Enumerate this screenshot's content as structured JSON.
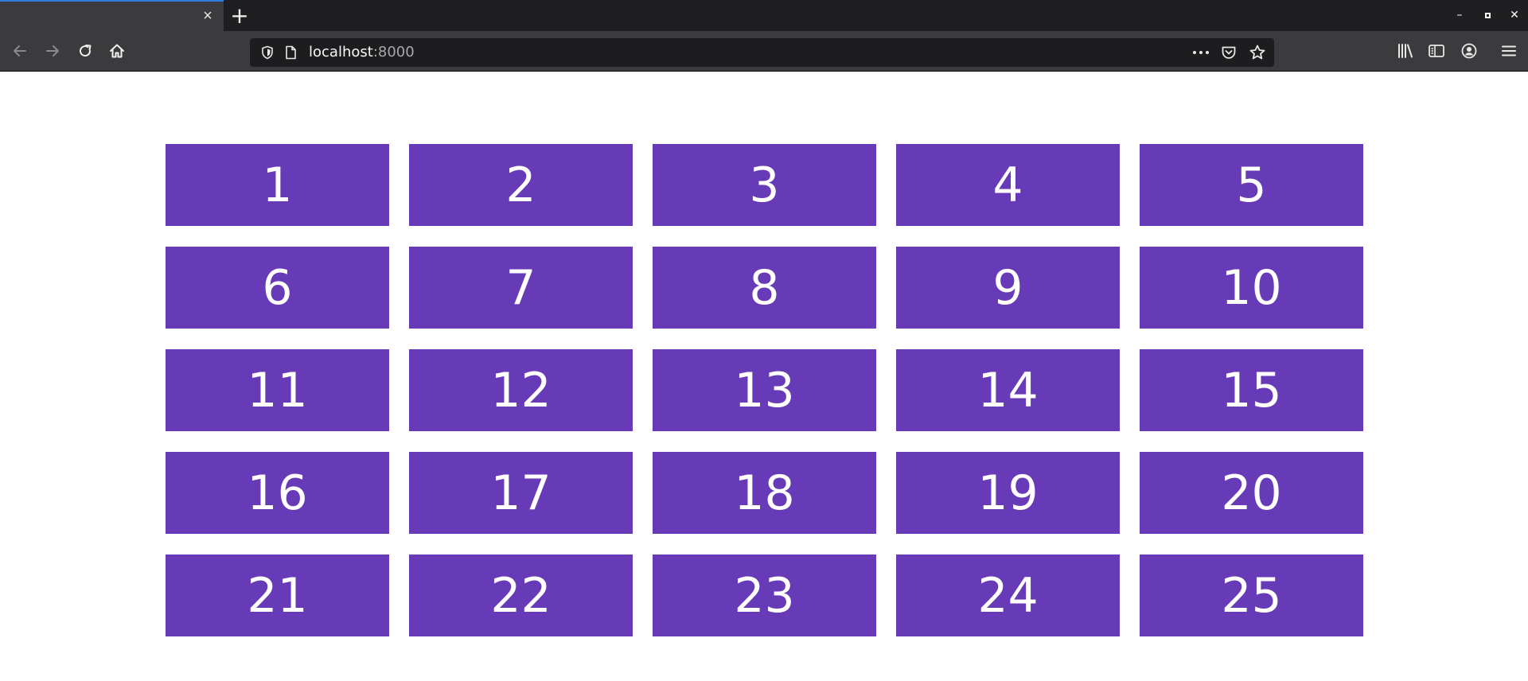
{
  "browser": {
    "tab": {
      "close_glyph": "×"
    },
    "new_tab_glyph": "+",
    "window_controls": {
      "minimize_glyph": "–",
      "close_glyph": "✕"
    },
    "nav": {
      "back_icon": "arrow-left-icon",
      "forward_icon": "arrow-right-icon",
      "reload_icon": "reload-icon",
      "home_icon": "home-icon"
    },
    "url": {
      "host": "localhost",
      "port": ":8000"
    },
    "url_actions": [
      "more-icon",
      "pocket-icon",
      "star-icon"
    ],
    "toolbar_icons": [
      "library-icon",
      "sidebar-icon",
      "account-icon",
      "menu-icon"
    ]
  },
  "colors": {
    "cell_background": "#673ab7",
    "cell_text": "#ffffff",
    "toolbar": "#3b3b3e",
    "tabstrip": "#1f1f22",
    "urlbar": "#1d1d20"
  },
  "grid": {
    "columns": 5,
    "cells": [
      "1",
      "2",
      "3",
      "4",
      "5",
      "6",
      "7",
      "8",
      "9",
      "10",
      "11",
      "12",
      "13",
      "14",
      "15",
      "16",
      "17",
      "18",
      "19",
      "20",
      "21",
      "22",
      "23",
      "24",
      "25"
    ]
  }
}
